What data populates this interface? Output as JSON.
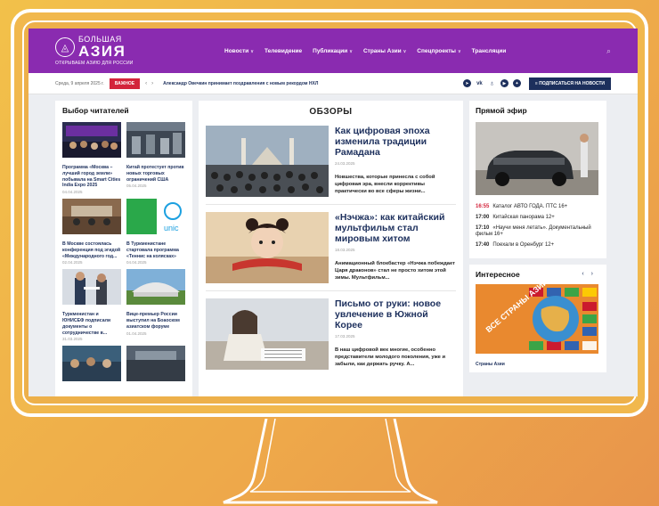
{
  "colors": {
    "brand": "#8a2bb0",
    "navy": "#1c2f5c",
    "accent": "#d3243b",
    "frame": "#ffffff"
  },
  "header": {
    "logo_small": "БОЛЬШАЯ",
    "logo_big": "АЗИЯ",
    "logo_tagline": "ОТКРЫВАЕМ АЗИЮ ДЛЯ РОССИИ",
    "nav": [
      {
        "label": "Новости",
        "dropdown": true
      },
      {
        "label": "Телевидение",
        "dropdown": false
      },
      {
        "label": "Публикации",
        "dropdown": true
      },
      {
        "label": "Страны Азии",
        "dropdown": true
      },
      {
        "label": "Спецпроекты",
        "dropdown": true
      },
      {
        "label": "Трансляции",
        "dropdown": false
      }
    ],
    "search_icon": "search-icon"
  },
  "ticker": {
    "date": "Среда, 9 апреля 2025 г.",
    "badge": "ВАЖНОЕ",
    "headline": "Александр Овечкин принимает поздравления с новым рекордом НХЛ",
    "socials": [
      "telegram-icon",
      "vk-icon",
      "ok-icon",
      "rutube-icon",
      "dzen-icon"
    ],
    "subscribe": "ПОДПИСАТЬСЯ НА НОВОСТИ"
  },
  "readers_choice": {
    "title": "Выбор читателей",
    "items": [
      {
        "title": "Программа «Москва – лучший город земли» побывала на Smart Cities India Expo 2025",
        "date": "04.04.2025"
      },
      {
        "title": "Китай протестует против новых торговых ограничений США",
        "date": "05.04.2025"
      },
      {
        "title": "В Москве состоялась конференция под эгидой «Международного год...",
        "date": "02.04.2025"
      },
      {
        "title": "В Туркменистане стартовала программа «Теннис на колясках»",
        "date": "04.04.2025"
      },
      {
        "title": "Туркменистан и ЮНИСЕФ подписали документы о сотрудничестве в...",
        "date": "31.03.2025"
      },
      {
        "title": "Вице-премьер России выступил на Боаоском азиатском форуме",
        "date": "01.04.2025"
      },
      {
        "title": "",
        "date": ""
      },
      {
        "title": "",
        "date": ""
      }
    ]
  },
  "reviews": {
    "title": "ОБЗОРЫ",
    "items": [
      {
        "title": "Как цифровая эпоха изменила традиции Рамадана",
        "date": "24.03.2025",
        "lead": "Новшества, которые принесла с собой цифровая эра, внесли коррективы практически во все сферы жизни..."
      },
      {
        "title": "«Нэчжа»: как китайский мультфильм стал мировым хитом",
        "date": "18.03.2025",
        "lead": "Анимационный блокбастер «Нэчжа побеждает Царя драконов» стал не просто хитом этой зимы. Мультфильм..."
      },
      {
        "title": "Письмо от руки: новое увлечение в Южной Корее",
        "date": "17.03.2025",
        "lead": "В наш цифровой век многие, особенно представители молодого поколения, уже и забыли, как держать ручку. А..."
      }
    ]
  },
  "live": {
    "title": "Прямой эфир",
    "schedule": [
      {
        "time": "16:55",
        "show": "Каталог АВТО ГОДА. ПТС 16+",
        "now": true
      },
      {
        "time": "17:00",
        "show": "Китайская панорама 12+",
        "now": false
      },
      {
        "time": "17:10",
        "show": "«Научи меня летать». Документальный фильм 16+",
        "now": false
      },
      {
        "time": "17:40",
        "show": "Поехали в Оренбург 12+",
        "now": false
      }
    ]
  },
  "interesting": {
    "title": "Интересное",
    "caption": "Страны Азии",
    "image_text": "ВСЕ СТРАНЫ АЗИИ"
  }
}
